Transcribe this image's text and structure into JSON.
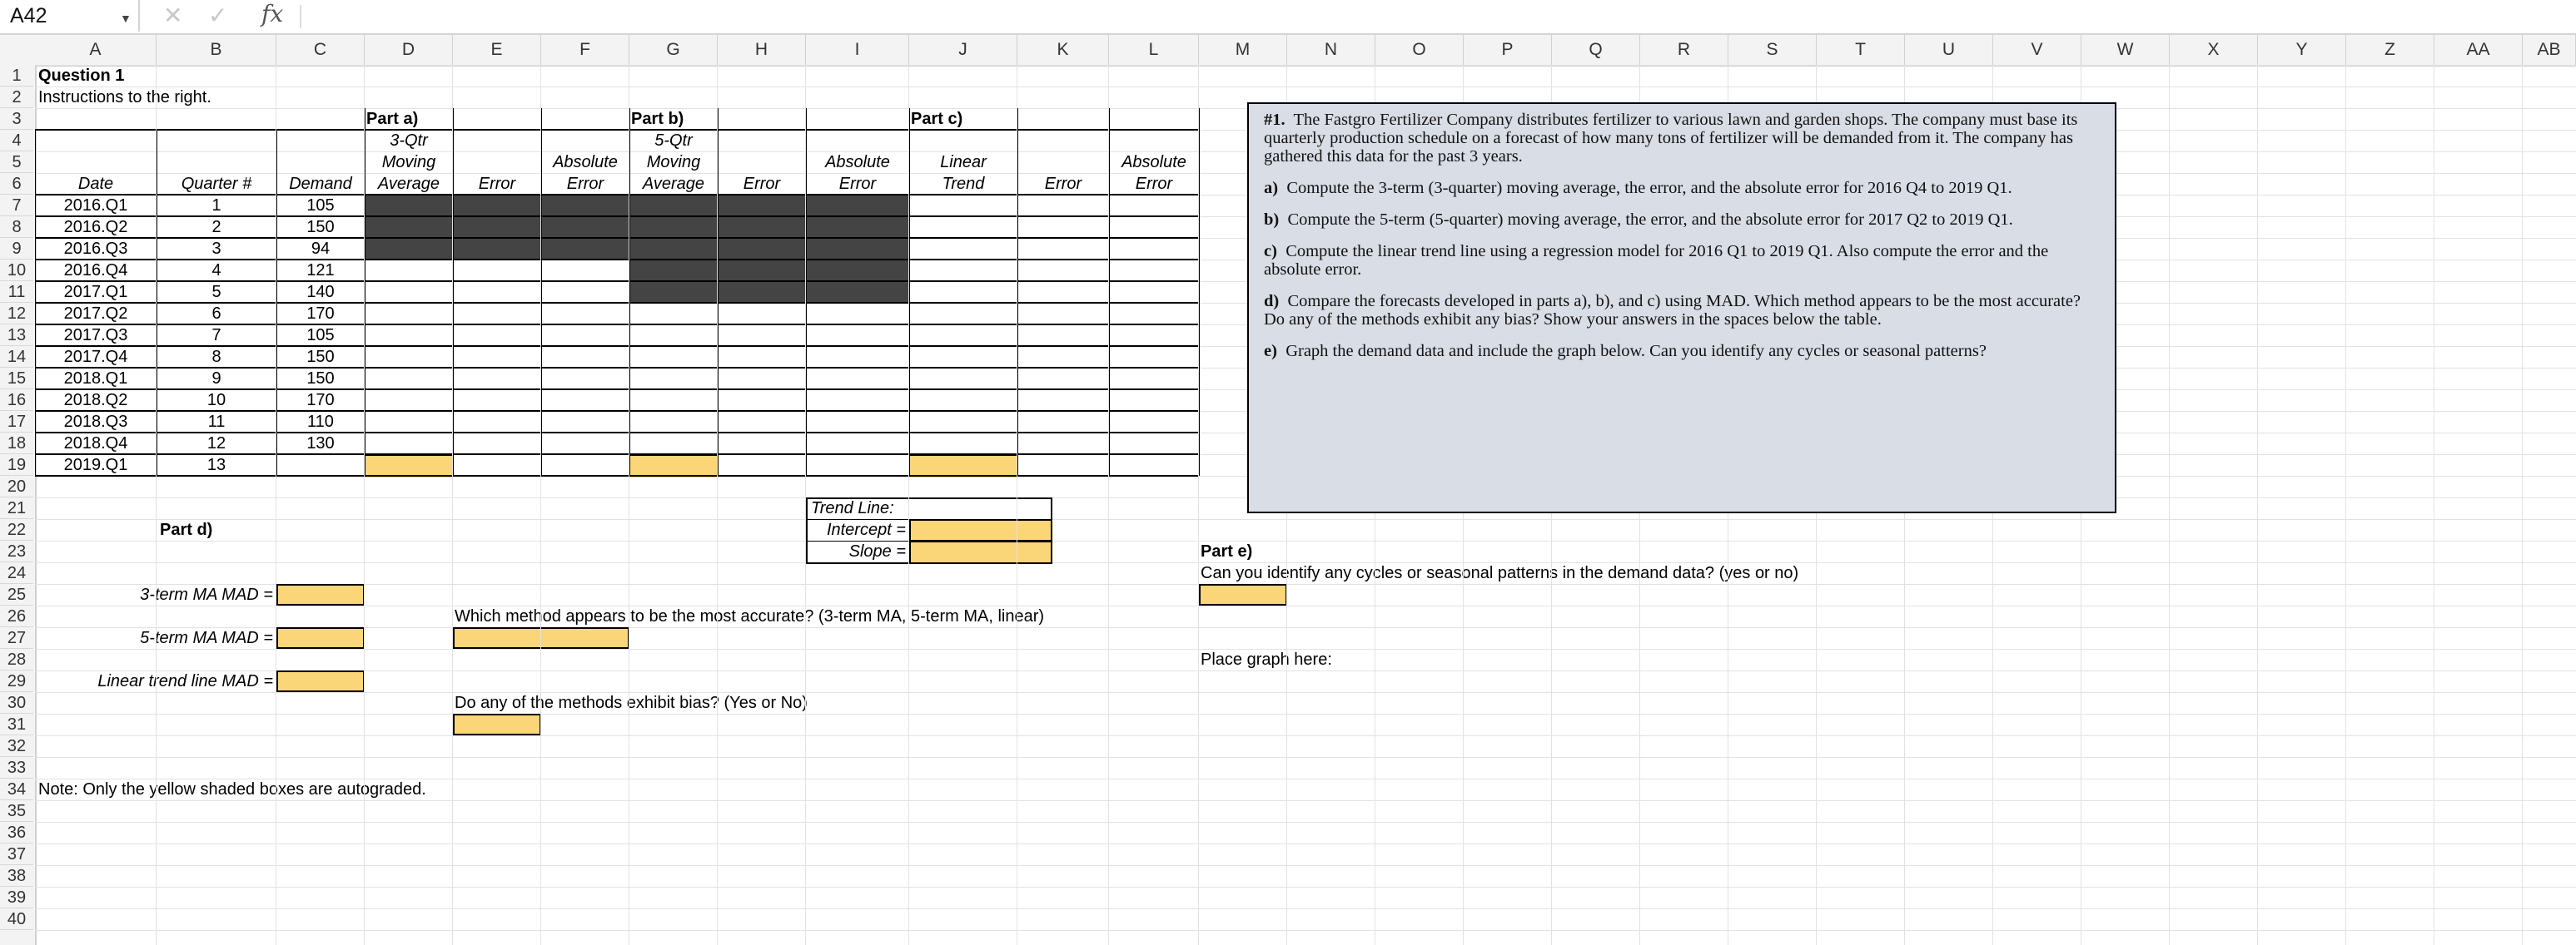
{
  "formula_bar": {
    "name_box": "A42",
    "cancel": "✕",
    "enter": "✓",
    "fx": "fx",
    "formula": ""
  },
  "columns": [
    "A",
    "B",
    "C",
    "D",
    "E",
    "F",
    "G",
    "H",
    "I",
    "J",
    "K",
    "L",
    "M",
    "N",
    "O",
    "P",
    "Q",
    "R",
    "S",
    "T",
    "U",
    "V",
    "W",
    "X",
    "Y",
    "Z",
    "AA",
    "AB"
  ],
  "rows": [
    "1",
    "2",
    "3",
    "4",
    "5",
    "6",
    "7",
    "8",
    "9",
    "10",
    "11",
    "12",
    "13",
    "14",
    "15",
    "16",
    "17",
    "18",
    "19",
    "20",
    "21",
    "22",
    "23",
    "24",
    "25",
    "26",
    "27",
    "28",
    "29",
    "30",
    "31",
    "32",
    "33",
    "34",
    "35",
    "36",
    "37",
    "38",
    "39",
    "40"
  ],
  "sheet": {
    "title": "Question 1",
    "instructions_note": "Instructions to the right.",
    "part_a": "Part a)",
    "part_b": "Part b)",
    "part_c": "Part c)",
    "hdr_3qtr": "3-Qtr",
    "hdr_5qtr": "5-Qtr",
    "hdr_linear": "Linear",
    "hdr_moving": "Moving",
    "hdr_absolute": "Absolute",
    "hdr_average": "Average",
    "hdr_error": "Error",
    "hdr_trend": "Trend",
    "hdr_date": "Date",
    "hdr_quarter": "Quarter #",
    "hdr_demand": "Demand",
    "table_rows": [
      {
        "date": "2016.Q1",
        "q": "1",
        "d": "105"
      },
      {
        "date": "2016.Q2",
        "q": "2",
        "d": "150"
      },
      {
        "date": "2016.Q3",
        "q": "3",
        "d": "94"
      },
      {
        "date": "2016.Q4",
        "q": "4",
        "d": "121"
      },
      {
        "date": "2017.Q1",
        "q": "5",
        "d": "140"
      },
      {
        "date": "2017.Q2",
        "q": "6",
        "d": "170"
      },
      {
        "date": "2017.Q3",
        "q": "7",
        "d": "105"
      },
      {
        "date": "2017.Q4",
        "q": "8",
        "d": "150"
      },
      {
        "date": "2018.Q1",
        "q": "9",
        "d": "150"
      },
      {
        "date": "2018.Q2",
        "q": "10",
        "d": "170"
      },
      {
        "date": "2018.Q3",
        "q": "11",
        "d": "110"
      },
      {
        "date": "2018.Q4",
        "q": "12",
        "d": "130"
      },
      {
        "date": "2019.Q1",
        "q": "13",
        "d": ""
      }
    ],
    "trend_line": "Trend Line:",
    "intercept": "Intercept =",
    "slope": "Slope =",
    "part_d": "Part d)",
    "mad_3": "3-term MA MAD =",
    "mad_5": "5-term MA MAD =",
    "mad_lin": "Linear trend line MAD =",
    "q_accurate": "Which method appears to be the most accurate? (3-term MA, 5-term MA, linear)",
    "q_bias": "Do any of the methods exhibit bias? (Yes or No)",
    "part_e": "Part e)",
    "q_cycles": "Can you identify any cycles or seasonal patterns in the demand data? (yes or no)",
    "place_graph": "Place graph here:",
    "note": "Note: Only the yellow shaded boxes are autograded."
  },
  "instructions_box": {
    "p1_num": "#1.",
    "p1": "The Fastgro Fertilizer Company distributes fertilizer to various lawn and garden shops.  The company must base its quarterly production schedule on a forecast of how many tons of fertilizer will be demanded from it.  The company has gathered this data for the past 3 years.",
    "pa_lbl": "a)",
    "pa": "Compute the 3-term (3-quarter) moving average, the error, and the absolute error for 2016 Q4 to 2019 Q1.",
    "pb_lbl": "b)",
    "pb": "Compute the 5-term (5-quarter) moving average, the error, and the absolute error for 2017 Q2 to 2019 Q1.",
    "pc_lbl": "c)",
    "pc": "Compute the linear trend line using a regression model for 2016 Q1 to 2019 Q1.  Also compute the error and the absolute error.",
    "pd_lbl": "d)",
    "pd": "Compare the forecasts developed in parts a), b), and c) using MAD. Which method appears to be the most accurate?  Do any of the methods exhibit any bias?  Show your answers in the spaces below the table.",
    "pe_lbl": "e)",
    "pe": "Graph the demand data and include the graph below.  Can you identify any cycles or seasonal patterns?"
  }
}
